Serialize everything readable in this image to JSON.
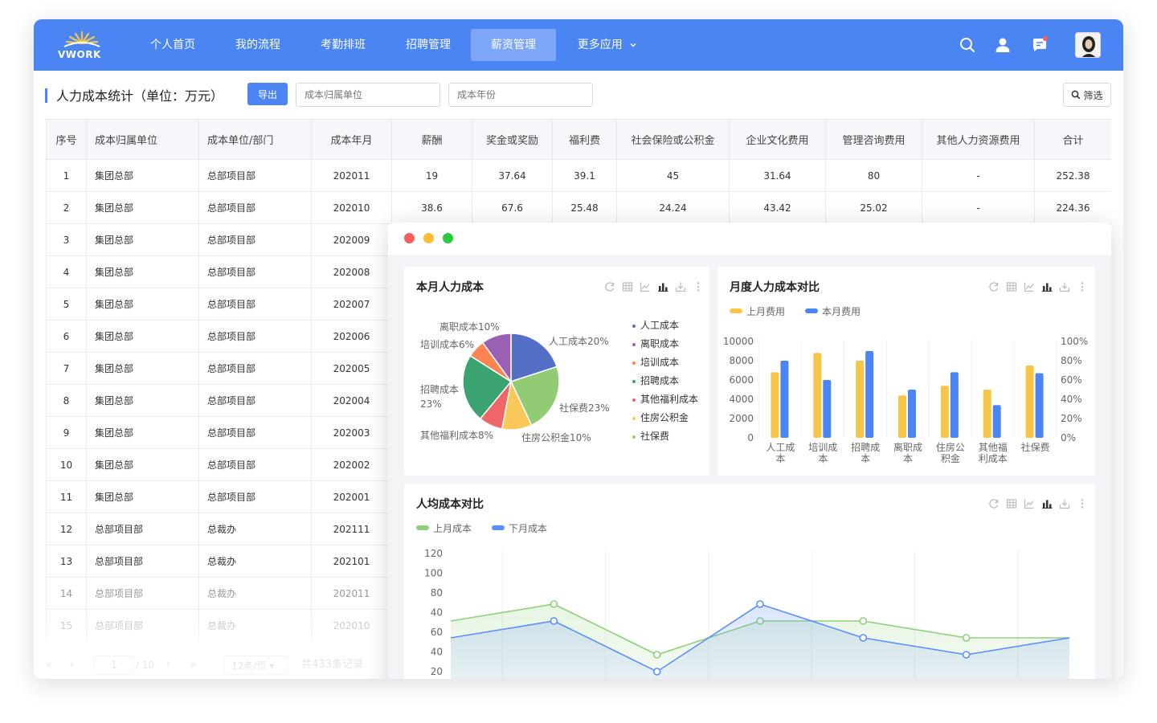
{
  "nav": {
    "logo_text": "VWORK",
    "items": [
      {
        "label": "个人首页"
      },
      {
        "label": "我的流程"
      },
      {
        "label": "考勤排班"
      },
      {
        "label": "招聘管理"
      },
      {
        "label": "薪资管理",
        "active": true
      },
      {
        "label": "更多应用"
      }
    ],
    "icons": [
      "search-icon",
      "user-icon",
      "message-icon"
    ],
    "accent": "#4a85f3"
  },
  "toolbar": {
    "title": "人力成本统计（单位：万元）",
    "export_label": "导出",
    "unit_placeholder": "成本归属单位",
    "year_placeholder": "成本年份",
    "filter_label": "筛选"
  },
  "table": {
    "columns": [
      "序号",
      "成本归属单位",
      "成本单位/部门",
      "成本年月",
      "薪酬",
      "奖金或奖励",
      "福利费",
      "社会保险或公积金",
      "企业文化费用",
      "管理咨询费用",
      "其他人力资源费用",
      "合计"
    ],
    "rows": [
      [
        "1",
        "集团总部",
        "总部项目部",
        "202011",
        "19",
        "37.64",
        "39.1",
        "45",
        "31.64",
        "80",
        "-",
        "252.38"
      ],
      [
        "2",
        "集团总部",
        "总部项目部",
        "202010",
        "38.6",
        "67.6",
        "25.48",
        "24.24",
        "43.42",
        "25.02",
        "-",
        "224.36"
      ],
      [
        "3",
        "集团总部",
        "总部项目部",
        "202009",
        "",
        "",
        "",
        "",
        "",
        "",
        "",
        ""
      ],
      [
        "4",
        "集团总部",
        "总部项目部",
        "202008",
        "",
        "",
        "",
        "",
        "",
        "",
        "",
        ""
      ],
      [
        "5",
        "集团总部",
        "总部项目部",
        "202007",
        "",
        "",
        "",
        "",
        "",
        "",
        "",
        ""
      ],
      [
        "6",
        "集团总部",
        "总部项目部",
        "202006",
        "",
        "",
        "",
        "",
        "",
        "",
        "",
        ""
      ],
      [
        "7",
        "集团总部",
        "总部项目部",
        "202005",
        "",
        "",
        "",
        "",
        "",
        "",
        "",
        ""
      ],
      [
        "8",
        "集团总部",
        "总部项目部",
        "202004",
        "",
        "",
        "",
        "",
        "",
        "",
        "",
        ""
      ],
      [
        "9",
        "集团总部",
        "总部项目部",
        "202003",
        "",
        "",
        "",
        "",
        "",
        "",
        "",
        ""
      ],
      [
        "10",
        "集团总部",
        "总部项目部",
        "202002",
        "",
        "",
        "",
        "",
        "",
        "",
        "",
        ""
      ],
      [
        "11",
        "集团总部",
        "总部项目部",
        "202001",
        "",
        "",
        "",
        "",
        "",
        "",
        "",
        ""
      ],
      [
        "12",
        "总部项目部",
        "总裁办",
        "202111",
        "",
        "",
        "",
        "",
        "",
        "",
        "",
        ""
      ],
      [
        "13",
        "总部项目部",
        "总裁办",
        "202101",
        "",
        "",
        "",
        "",
        "",
        "",
        "",
        ""
      ],
      [
        "14",
        "总部项目部",
        "总裁办",
        "202011",
        "",
        "",
        "",
        "",
        "",
        "",
        "",
        ""
      ],
      [
        "15",
        "总部项目部",
        "总裁办",
        "202010",
        "",
        "",
        "",
        "",
        "",
        "",
        "",
        ""
      ]
    ]
  },
  "pager": {
    "first": "«",
    "prev": "‹",
    "page": "1",
    "total_pages": "/ 10",
    "next": "›",
    "last": "»",
    "page_size": "12条/页",
    "total": "共433条记录"
  },
  "dashboard": {
    "window_dots": [
      "#f4605b",
      "#f9bd2f",
      "#2bc840"
    ],
    "pie_card": {
      "title": "本月人力成本"
    },
    "bar_card": {
      "title": "月度人力成本对比"
    },
    "line_card": {
      "title": "人均成本对比"
    }
  },
  "chart_data": [
    {
      "type": "pie",
      "title": "本月人力成本",
      "slices": [
        {
          "name": "人工成本",
          "label": "人工成本20%",
          "value": 20,
          "color": "#5470c6"
        },
        {
          "name": "社保费",
          "label": "社保费23%",
          "value": 23,
          "color": "#91cc75"
        },
        {
          "name": "住房公积金",
          "label": "住房公积金10%",
          "value": 10,
          "color": "#fac858"
        },
        {
          "name": "其他福利成本",
          "label": "其他福利成本8%",
          "value": 8,
          "color": "#ee6666"
        },
        {
          "name": "招聘成本",
          "label": "招聘成本\n23%",
          "value": 23,
          "color": "#3ba272"
        },
        {
          "name": "培训成本",
          "label": "培训成本6%",
          "value": 6,
          "color": "#fc8452"
        },
        {
          "name": "离职成本",
          "label": "离职成本10%",
          "value": 10,
          "color": "#9a60b4"
        }
      ],
      "legend": [
        {
          "name": "人工成本",
          "color": "#5470c6"
        },
        {
          "name": "离职成本",
          "color": "#9a60b4"
        },
        {
          "name": "培训成本",
          "color": "#fc8452"
        },
        {
          "name": "招聘成本",
          "color": "#3ba272"
        },
        {
          "name": "其他福利成本",
          "color": "#ee6666"
        },
        {
          "name": "住房公积金",
          "color": "#fac858"
        },
        {
          "name": "社保费",
          "color": "#91cc75"
        }
      ],
      "legend_position": "right"
    },
    {
      "type": "bar",
      "title": "月度人力成本对比",
      "categories": [
        "人工成本",
        "培训成本",
        "招聘成本",
        "离职成本",
        "住房公积金",
        "其他福利成本",
        "社保费"
      ],
      "category_lines": [
        [
          "人工成",
          "本"
        ],
        [
          "培训成",
          "本"
        ],
        [
          "招聘成",
          "本"
        ],
        [
          "离职成",
          "本"
        ],
        [
          "住房公",
          "积金"
        ],
        [
          "其他福",
          "利成本"
        ],
        [
          "社保费"
        ]
      ],
      "series": [
        {
          "name": "上月费用",
          "color": "#f7c649",
          "values": [
            6800,
            8800,
            8000,
            4400,
            5400,
            5000,
            7500
          ]
        },
        {
          "name": "本月费用",
          "color": "#4a85f3",
          "values": [
            8000,
            6000,
            9000,
            5000,
            6800,
            3400,
            6700
          ]
        }
      ],
      "ylim": [
        0,
        10000
      ],
      "yticks": [
        "0",
        "2000",
        "4000",
        "6000",
        "8000",
        "10000"
      ],
      "y2ticks": [
        "0%",
        "20%",
        "40%",
        "60%",
        "80%",
        "100%"
      ],
      "legend_position": "top-left"
    },
    {
      "type": "line",
      "title": "人均成本对比",
      "series": [
        {
          "name": "上月成本",
          "color": "#8fd07a",
          "values": [
            40,
            60,
            0,
            40,
            40,
            20,
            20
          ]
        },
        {
          "name": "下月成本",
          "color": "#5b8ff9",
          "values": [
            20,
            40,
            -20,
            60,
            20,
            0,
            20
          ]
        }
      ],
      "ylim": [
        -20,
        120
      ],
      "ytick_labels": [
        "120",
        "100",
        "80",
        "40",
        "60",
        "40",
        "20"
      ],
      "legend_position": "top-left"
    }
  ]
}
